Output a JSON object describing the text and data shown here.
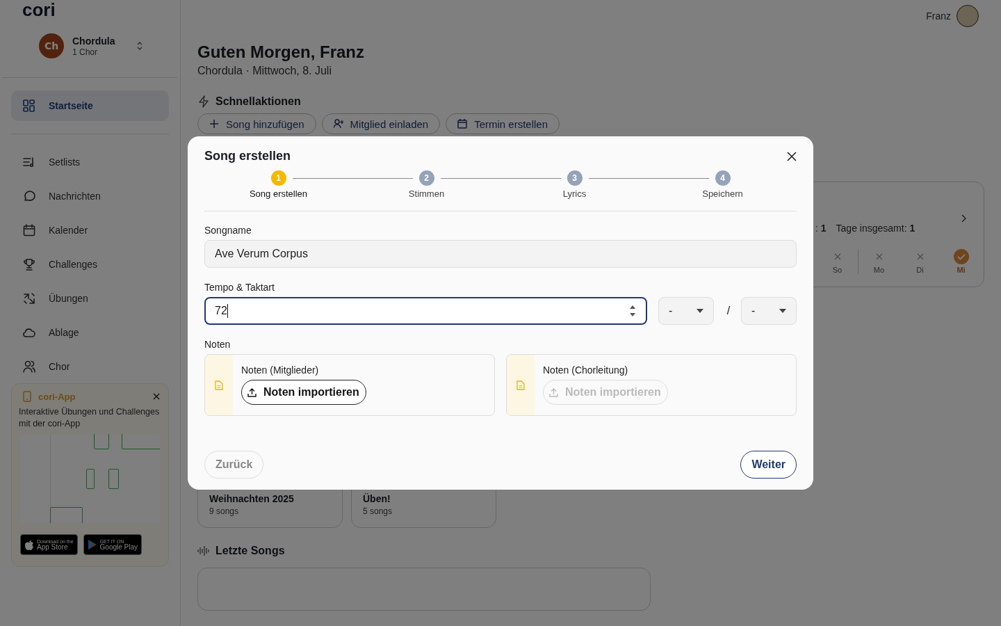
{
  "sidebar": {
    "logo": "cori",
    "workspace": {
      "initials": "Ch",
      "name": "Chordula",
      "subtitle": "1 Chor"
    },
    "items": [
      {
        "label": "Startseite",
        "selected": true
      },
      {
        "label": "Setlists",
        "selected": false
      },
      {
        "label": "Nachrichten",
        "selected": false
      },
      {
        "label": "Kalender",
        "selected": false
      },
      {
        "label": "Challenges",
        "selected": false
      },
      {
        "label": "Übungen",
        "selected": false
      },
      {
        "label": "Ablage",
        "selected": false
      },
      {
        "label": "Chor",
        "selected": false
      }
    ],
    "promo": {
      "title": "cori-App",
      "text": "Interaktive Übungen und Challenges mit der cori-App",
      "badges": [
        {
          "kind": "apple",
          "small": "Download on the",
          "big": "App Store"
        },
        {
          "kind": "play",
          "small": "GET IT ON",
          "big": "Google Play"
        }
      ]
    }
  },
  "header": {
    "user": "Franz"
  },
  "greeting": {
    "title": "Guten Morgen, Franz",
    "subtitle": "Chordula · Mittwoch, 8. Juli"
  },
  "quick_actions": {
    "title": "Schnellaktionen",
    "buttons": [
      {
        "label": "Song hinzufügen"
      },
      {
        "label": "Mitglied einladen"
      },
      {
        "label": "Termin erstellen"
      }
    ]
  },
  "streak": {
    "stats": [
      ": **1**",
      "Tage insgesamt: **1**"
    ],
    "days": [
      {
        "label": "So",
        "done": false
      },
      {
        "label": "Mo",
        "done": false
      },
      {
        "label": "Di",
        "done": false
      },
      {
        "label": "Mi",
        "done": true
      }
    ]
  },
  "setlists": [
    {
      "name": "Weihnachten 2025",
      "count": "9 songs"
    },
    {
      "name": "Üben!",
      "count": "5 songs"
    }
  ],
  "recent_songs": {
    "title": "Letzte Songs"
  },
  "dialog": {
    "title": "Song erstellen",
    "steps": [
      {
        "number": "1",
        "label": "Song erstellen",
        "selected": true
      },
      {
        "number": "2",
        "label": "Stimmen",
        "selected": false
      },
      {
        "number": "3",
        "label": "Lyrics",
        "selected": false
      },
      {
        "number": "4",
        "label": "Speichern",
        "selected": false
      }
    ],
    "songname": {
      "label": "Songname",
      "value": "Ave Verum Corpus"
    },
    "tempo": {
      "label": "Tempo & Taktart",
      "value": "72",
      "focused": true,
      "beats": "-",
      "separator": "/",
      "unit": "-"
    },
    "noten": {
      "label": "Noten",
      "cards": [
        {
          "title": "Noten (Mitglieder)",
          "button": "Noten importieren",
          "disabled": false
        },
        {
          "title": "Noten (Chorleitung)",
          "button": "Noten importieren",
          "disabled": true
        }
      ]
    },
    "back": {
      "label": "Zurück",
      "disabled": true
    },
    "next": {
      "label": "Weiter",
      "disabled": false
    }
  }
}
